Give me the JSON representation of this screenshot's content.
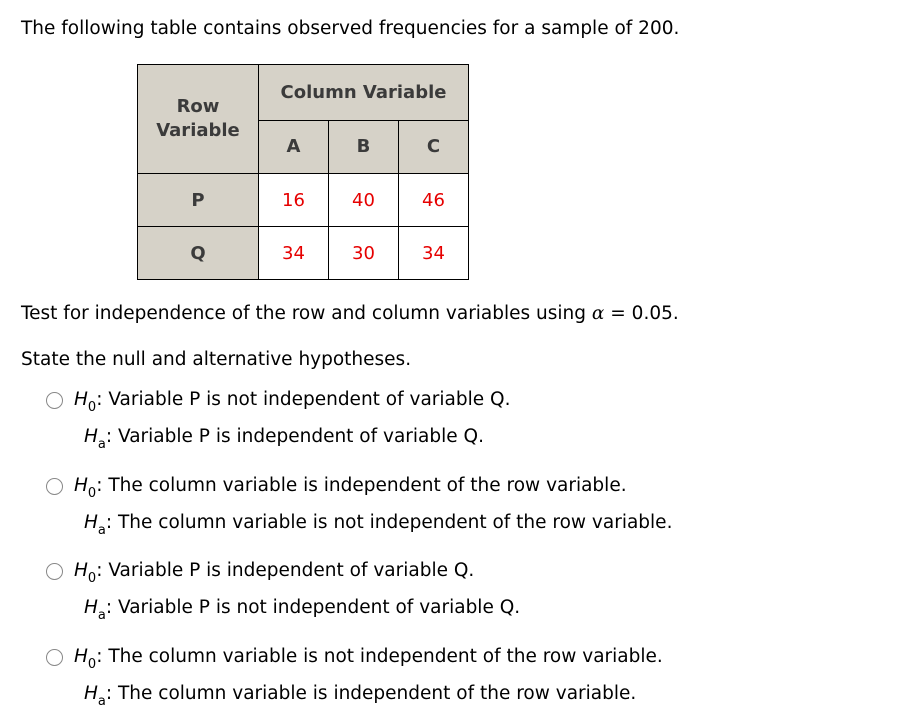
{
  "intro": "The following table contains observed frequencies for a sample of 200.",
  "table": {
    "row_header": [
      "Row",
      "Variable"
    ],
    "column_header": "Column Variable",
    "columns": [
      "A",
      "B",
      "C"
    ],
    "rows": [
      {
        "label": "P",
        "values": [
          "16",
          "40",
          "46"
        ]
      },
      {
        "label": "Q",
        "values": [
          "34",
          "30",
          "34"
        ]
      }
    ],
    "value_color": "#e60000",
    "header_bg": "#d6d2c8"
  },
  "test_prompt": {
    "before": "Test for independence of the row and column variables using ",
    "alpha_symbol": "α",
    "after": " = 0.05."
  },
  "instruction": "State the null and alternative hypotheses.",
  "hyp": {
    "H": "H",
    "sub0": "0",
    "suba": "a"
  },
  "options": [
    {
      "h0": ": Variable P is not independent of variable Q.",
      "ha": ": Variable P is independent of variable Q."
    },
    {
      "h0": ": The column variable is independent of the row variable.",
      "ha": ": The column variable is not independent of the row variable."
    },
    {
      "h0": ": Variable P is independent of variable Q.",
      "ha": ": Variable P is not independent of variable Q."
    },
    {
      "h0": ": The column variable is not independent of the row variable.",
      "ha": ": The column variable is independent of the row variable."
    }
  ]
}
